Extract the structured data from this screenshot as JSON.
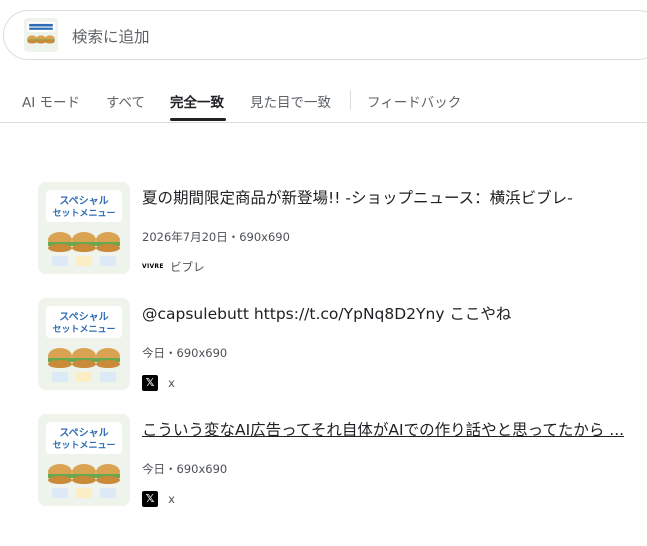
{
  "search": {
    "placeholder": "検索に追加"
  },
  "tabs": [
    {
      "label": "AI モード"
    },
    {
      "label": "すべて"
    },
    {
      "label": "完全一致"
    },
    {
      "label": "見た目で一致"
    },
    {
      "label": "フィードバック"
    }
  ],
  "results": [
    {
      "title": "夏の期間限定商品が新登場!! -ショップニュース：横浜ビブレ-",
      "meta": "2026年7月20日・690x690",
      "source": "ビブレ",
      "source_icon": "vivre-logo-icon"
    },
    {
      "title": "@capsulebutt https://t.co/YpNq8D2Yny ここやね",
      "meta": "今日・690x690",
      "source": "x",
      "source_icon": "x-logo-icon"
    },
    {
      "title": "こういう変なAI広告ってそれ自体がAIでの作り話やと思ってたから ...",
      "meta": "今日・690x690",
      "source": "x",
      "source_icon": "x-logo-icon"
    }
  ],
  "thumbnail": {
    "headline": "スペシャル",
    "headline2": "セットメニュー"
  },
  "colors": {
    "accent": "#202124",
    "thumb_blue": "#2f6db5",
    "thumb_bg": "#eef4ec"
  }
}
